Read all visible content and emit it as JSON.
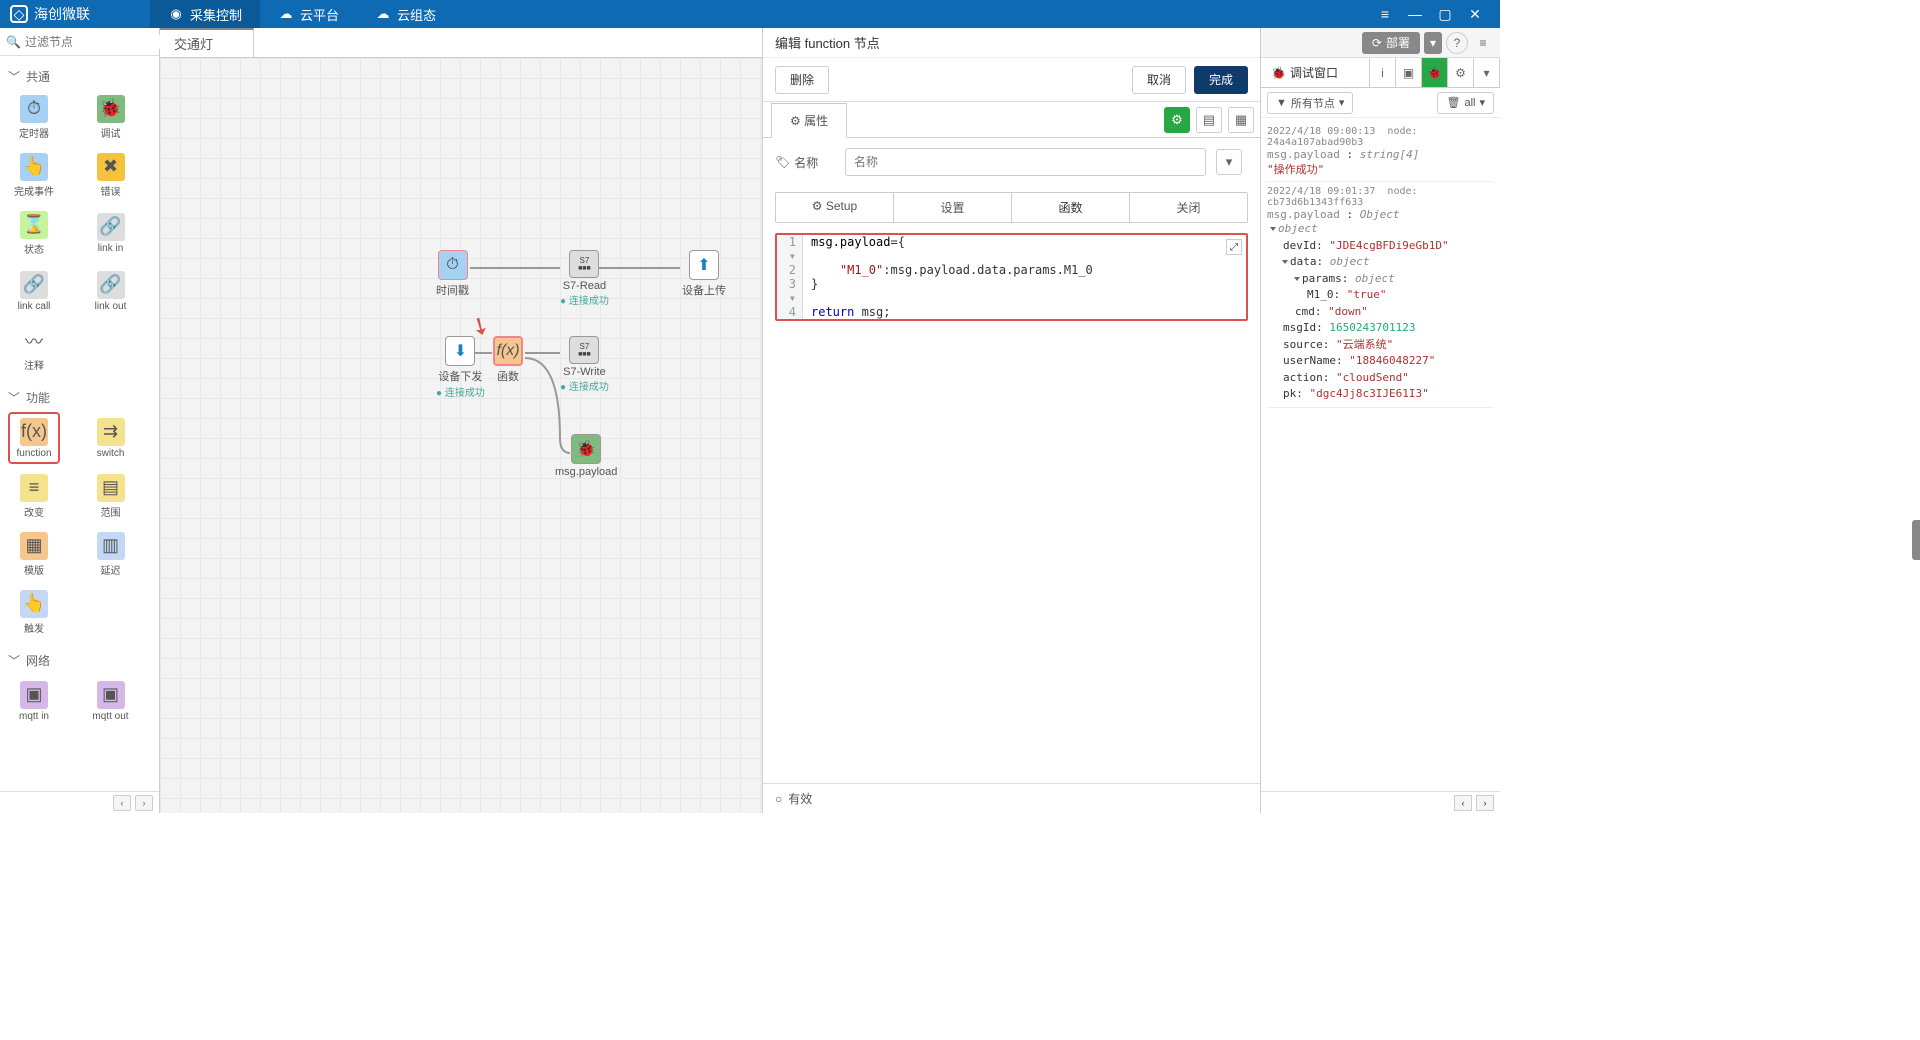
{
  "titlebar": {
    "brand": "海创微联",
    "nav": [
      "采集控制",
      "云平台",
      "云组态"
    ]
  },
  "palette": {
    "search_placeholder": "过滤节点",
    "cat_common": "共通",
    "cat_function": "功能",
    "cat_network": "网络",
    "common_nodes": [
      {
        "label": "定时器",
        "color": "#a6d1f5",
        "icon": "⏱"
      },
      {
        "label": "调试",
        "color": "#7fbb7f",
        "icon": "🐞"
      },
      {
        "label": "完成事件",
        "color": "#a6d1f5",
        "icon": "👆"
      },
      {
        "label": "错误",
        "color": "#f5c23e",
        "icon": "✖"
      },
      {
        "label": "状态",
        "color": "#c4f59a",
        "icon": "⌛"
      },
      {
        "label": "link in",
        "color": "#ddd",
        "icon": "🔗"
      },
      {
        "label": "link call",
        "color": "#ddd",
        "icon": "🔗"
      },
      {
        "label": "link out",
        "color": "#ddd",
        "icon": "🔗"
      },
      {
        "label": "注释",
        "color": "#fff",
        "icon": "〰"
      }
    ],
    "function_nodes": [
      {
        "label": "function",
        "color": "#f5c78e",
        "icon": "f(x)",
        "highlight": true
      },
      {
        "label": "switch",
        "color": "#f5e28e",
        "icon": "⇉"
      },
      {
        "label": "改变",
        "color": "#f5e28e",
        "icon": "≡"
      },
      {
        "label": "范围",
        "color": "#f5e28e",
        "icon": "▤"
      },
      {
        "label": "模版",
        "color": "#f5c78e",
        "icon": "▦"
      },
      {
        "label": "延迟",
        "color": "#c4d8f5",
        "icon": "▥"
      },
      {
        "label": "触发",
        "color": "#c4d8f5",
        "icon": "👆"
      }
    ],
    "network_nodes": [
      {
        "label": "mqtt in",
        "color": "#d6b8e8",
        "icon": "▣"
      },
      {
        "label": "mqtt out",
        "color": "#d6b8e8",
        "icon": "▣"
      }
    ]
  },
  "tabs": {
    "active": "交通灯"
  },
  "flow": {
    "n_time": "时间戳",
    "n_s7read": "S7-Read",
    "n_s7read_status": "连接成功",
    "n_devup": "设备上传",
    "n_devdown": "设备下发",
    "n_devdown_status": "连接成功",
    "n_func": "函数",
    "n_s7write": "S7-Write",
    "n_s7write_status": "连接成功",
    "n_debug": "msg.payload"
  },
  "edit": {
    "title": "编辑 function 节点",
    "delete": "删除",
    "cancel": "取消",
    "done": "完成",
    "prop_tab": "属性",
    "name_label": "名称",
    "name_placeholder": "名称",
    "subtabs": {
      "setup": "Setup",
      "setup_icon": "⚙",
      "set": "设置",
      "func": "函数",
      "close": "关闭"
    },
    "code": {
      "l1": "msg.payload={",
      "l2": "    \"M1_0\":msg.payload.data.params.M1_0",
      "l3": "}",
      "l4": "return msg;"
    },
    "footer": "有效"
  },
  "right": {
    "deploy": "部署",
    "debug_tab": "调试窗口",
    "filter_all_nodes": "所有节点",
    "filter_all": "all",
    "entry1": {
      "ts": "2022/4/18 09:00:13",
      "node": "node: 24a4a107abad90b3",
      "path": "msg.payload",
      "type": "string[4]",
      "val": "\"操作成功\""
    },
    "entry2": {
      "ts": "2022/4/18 09:01:37",
      "node": "node: cb73d6b1343ff633",
      "path": "msg.payload",
      "type": "Object",
      "root": "object",
      "devId_k": "devId:",
      "devId_v": "\"JDE4cgBFDi9eGb1D\"",
      "data_k": "data:",
      "data_v": "object",
      "params_k": "params:",
      "params_v": "object",
      "m10_k": "M1_0:",
      "m10_v": "\"true\"",
      "cmd_k": "cmd:",
      "cmd_v": "\"down\"",
      "msgId_k": "msgId:",
      "msgId_v": "1650243701123",
      "source_k": "source:",
      "source_v": "\"云端系统\"",
      "userName_k": "userName:",
      "userName_v": "\"18846048227\"",
      "action_k": "action:",
      "action_v": "\"cloudSend\"",
      "pk_k": "pk:",
      "pk_v": "\"dgc4Jj8c3IJE61I3\""
    }
  }
}
